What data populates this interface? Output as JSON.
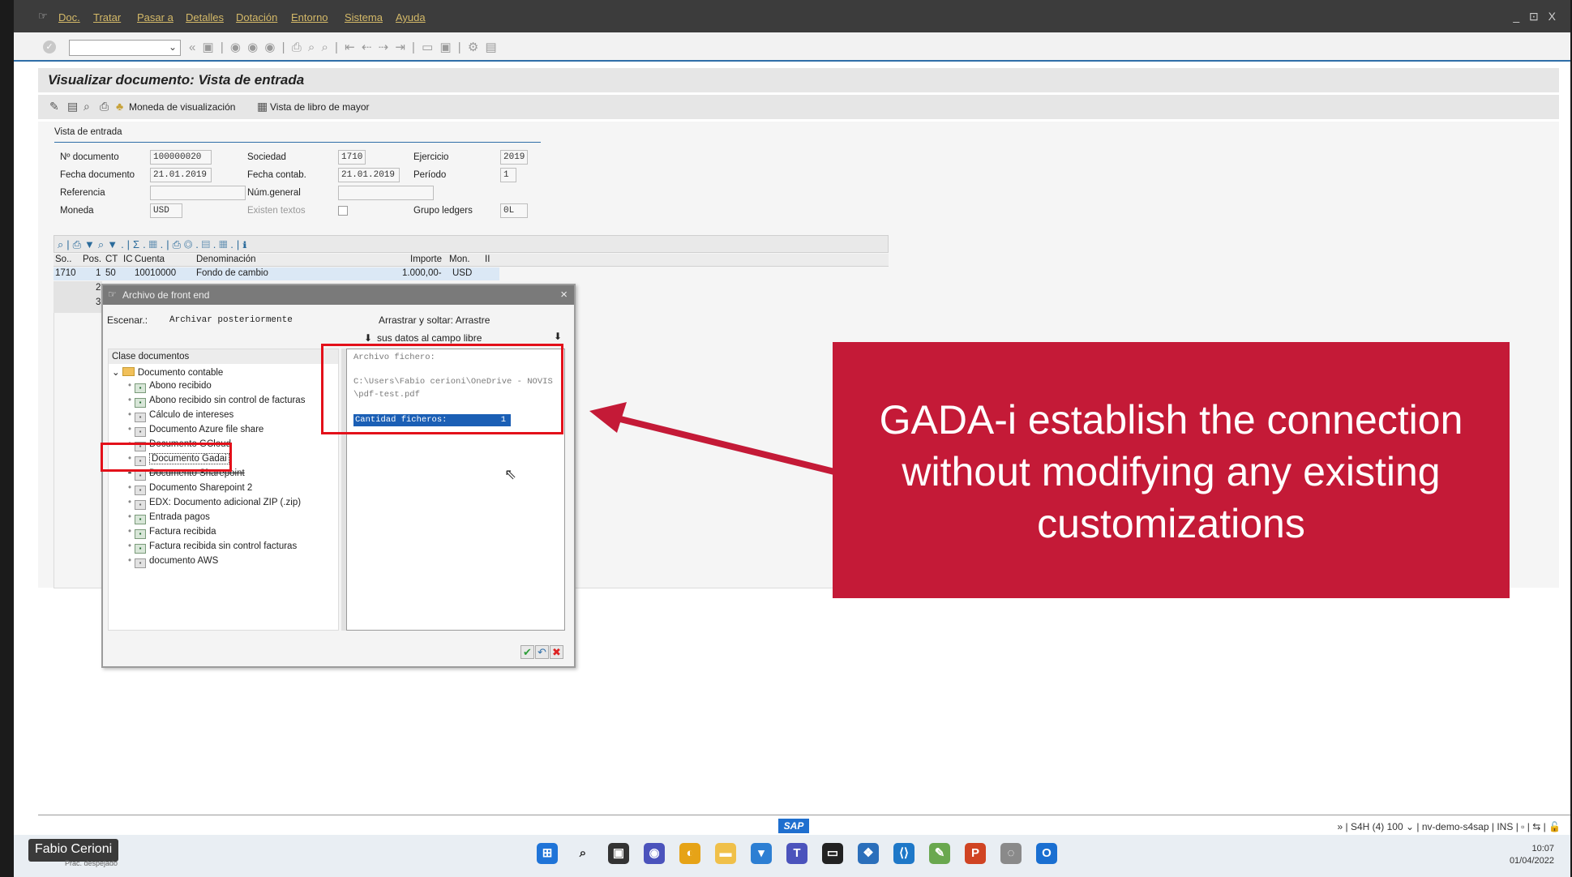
{
  "menu": {
    "items": [
      "Doc.",
      "Tratar",
      "Pasar a",
      "Detalles",
      "Dotación",
      "Entorno",
      "Sistema",
      "Ayuda"
    ]
  },
  "window_controls": "_ ⊡ X",
  "page_title": "Visualizar documento: Vista de entrada",
  "app_toolbar": {
    "display_currency": "Moneda de visualización",
    "ledger_view": "Vista de libro de mayor"
  },
  "header": {
    "panel_title": "Vista de entrada",
    "fields": {
      "doc_number_label": "Nº documento",
      "doc_number": "100000020",
      "company_label": "Sociedad",
      "company": "1710",
      "year_label": "Ejercicio",
      "year": "2019",
      "doc_date_label": "Fecha documento",
      "doc_date": "21.01.2019",
      "posting_date_label": "Fecha contab.",
      "posting_date": "21.01.2019",
      "period_label": "Período",
      "period": "1",
      "reference_label": "Referencia",
      "reference": "",
      "crossco_label": "Núm.general",
      "crossco": "",
      "currency_label": "Moneda",
      "currency": "USD",
      "texts_label": "Existen textos",
      "ledger_group_label": "Grupo ledgers",
      "ledger_group": "0L"
    }
  },
  "grid": {
    "columns": [
      "So..",
      "Pos.",
      "CT",
      "IC",
      "Cuenta",
      "Denominación",
      "Importe",
      "Mon.",
      "II"
    ],
    "row": {
      "so": "1710",
      "pos": "1",
      "ct": "50",
      "account": "10010000",
      "description": "Fondo de cambio",
      "amount": "1.000,00-",
      "currency": "USD"
    },
    "partial_rows": [
      "2",
      "3"
    ]
  },
  "dialog": {
    "title": "Archivo de front end",
    "scenario_label": "Escenar.:",
    "scenario_value": "Archivar posteriormente",
    "drag_hint_1": "Arrastrar y soltar: Arrastre",
    "drag_hint_2": "sus datos al campo libre",
    "tree_header": "Clase documentos",
    "tree_root": "Documento contable",
    "tree_items": [
      "Abono recibido",
      "Abono recibido sin control de facturas",
      "Cálculo de intereses",
      "Documento Azure file share",
      "Documento GCloud",
      "Documento Gadai",
      "Documento Sharepoint",
      "Documento Sharepoint 2",
      "EDX: Documento adicional ZIP (.zip)",
      "Entrada pagos",
      "Factura recibida",
      "Factura recibida sin control facturas",
      "documento AWS"
    ],
    "file_label": "Archivo fichero:",
    "file_path_1": "C:\\Users\\Fabio cerioni\\OneDrive - NOVIS",
    "file_path_2": "\\pdf-test.pdf",
    "qty_label": "Cantidad ficheros:",
    "qty_value": "1"
  },
  "callout": {
    "text": "GADA-i establish the connection without modifying any existing customizations",
    "color": "#c41a37"
  },
  "status": {
    "system": "S4H (4) 100",
    "server": "nv-demo-s4sap",
    "mode": "INS",
    "sap_logo": "SAP"
  },
  "taskbar": {
    "presenter": "Fabio Cerioni",
    "weather": "Prac. despejado",
    "time": "10:07",
    "date": "01/04/2022"
  }
}
